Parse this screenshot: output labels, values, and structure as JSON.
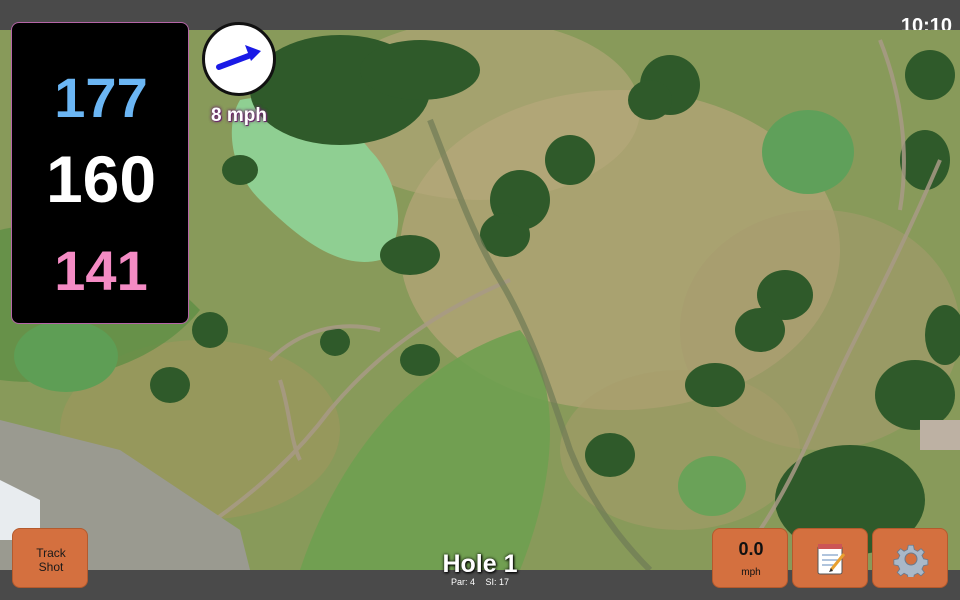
{
  "status_bar": {
    "time": "10:10"
  },
  "distances": {
    "back": "177",
    "center": "160",
    "front": "141"
  },
  "wind": {
    "speed_label": "8 mph",
    "direction_icon": "wind-arrow-icon"
  },
  "buttons": {
    "track_shot_line1": "Track",
    "track_shot_line2": "Shot",
    "speed_value": "0.0",
    "speed_unit": "mph",
    "notes_icon": "notepad-icon",
    "settings_icon": "gear-icon"
  },
  "hole": {
    "title": "Hole 1",
    "par": "Par: 4",
    "si": "SI: 17"
  },
  "colors": {
    "back_distance": "#6bb6f4",
    "center_distance": "#ffffff",
    "front_distance": "#f48bc4",
    "button_bg": "#d4703f",
    "panel_border": "#b565a7",
    "wind_arrow": "#1a1ae6"
  }
}
